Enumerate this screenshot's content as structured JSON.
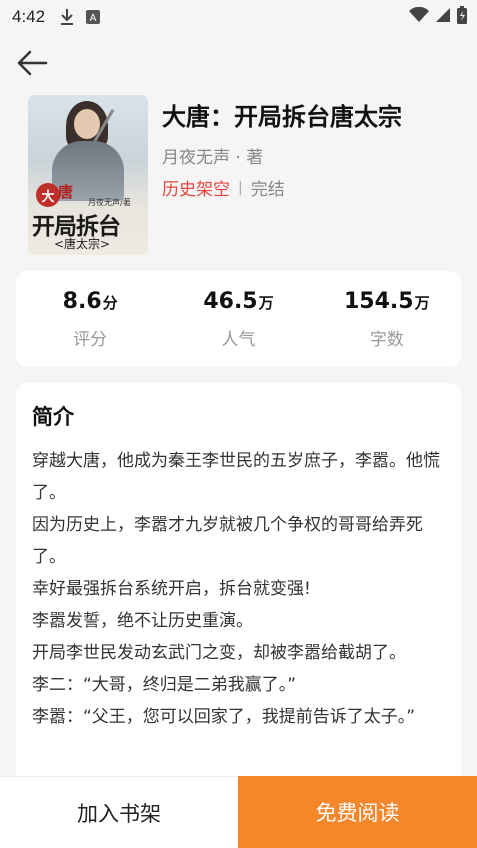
{
  "status_bar": {
    "time": "4:42",
    "icons": [
      "download-icon",
      "a-box-icon",
      "wifi-icon",
      "signal-icon",
      "battery-icon"
    ]
  },
  "cover_art": {
    "badge": "大",
    "badge_rest": "唐",
    "author": "月夜无声/著",
    "title": "开局拆台",
    "subtitle": "<唐太宗>"
  },
  "book": {
    "title": "大唐：开局拆台唐太宗",
    "author": "月夜无声 · 著",
    "category": "历史架空",
    "separator": "|",
    "status": "完结"
  },
  "stats": {
    "rating": {
      "value": "8.6",
      "unit": "分",
      "label": "评分"
    },
    "popularity": {
      "value": "46.5",
      "unit": "万",
      "label": "人气"
    },
    "words": {
      "value": "154.5",
      "unit": "万",
      "label": "字数"
    }
  },
  "intro": {
    "heading": "简介",
    "paragraphs": [
      "穿越大唐，他成为秦王李世民的五岁庶子，李嚣。他慌了。",
      "因为历史上，李嚣才九岁就被几个争权的哥哥给弄死了。",
      "幸好最强拆台系统开启，拆台就变强!",
      "李嚣发誓，绝不让历史重演。",
      "开局李世民发动玄武门之变，却被李嚣给截胡了。",
      "李二：“大哥，终归是二弟我赢了。”",
      "李嚣：“父王，您可以回家了，我提前告诉了太子。”"
    ]
  },
  "actions": {
    "add_shelf": "加入书架",
    "read_free": "免费阅读"
  },
  "colors": {
    "accent": "#f5862a",
    "category": "#e4473d"
  }
}
